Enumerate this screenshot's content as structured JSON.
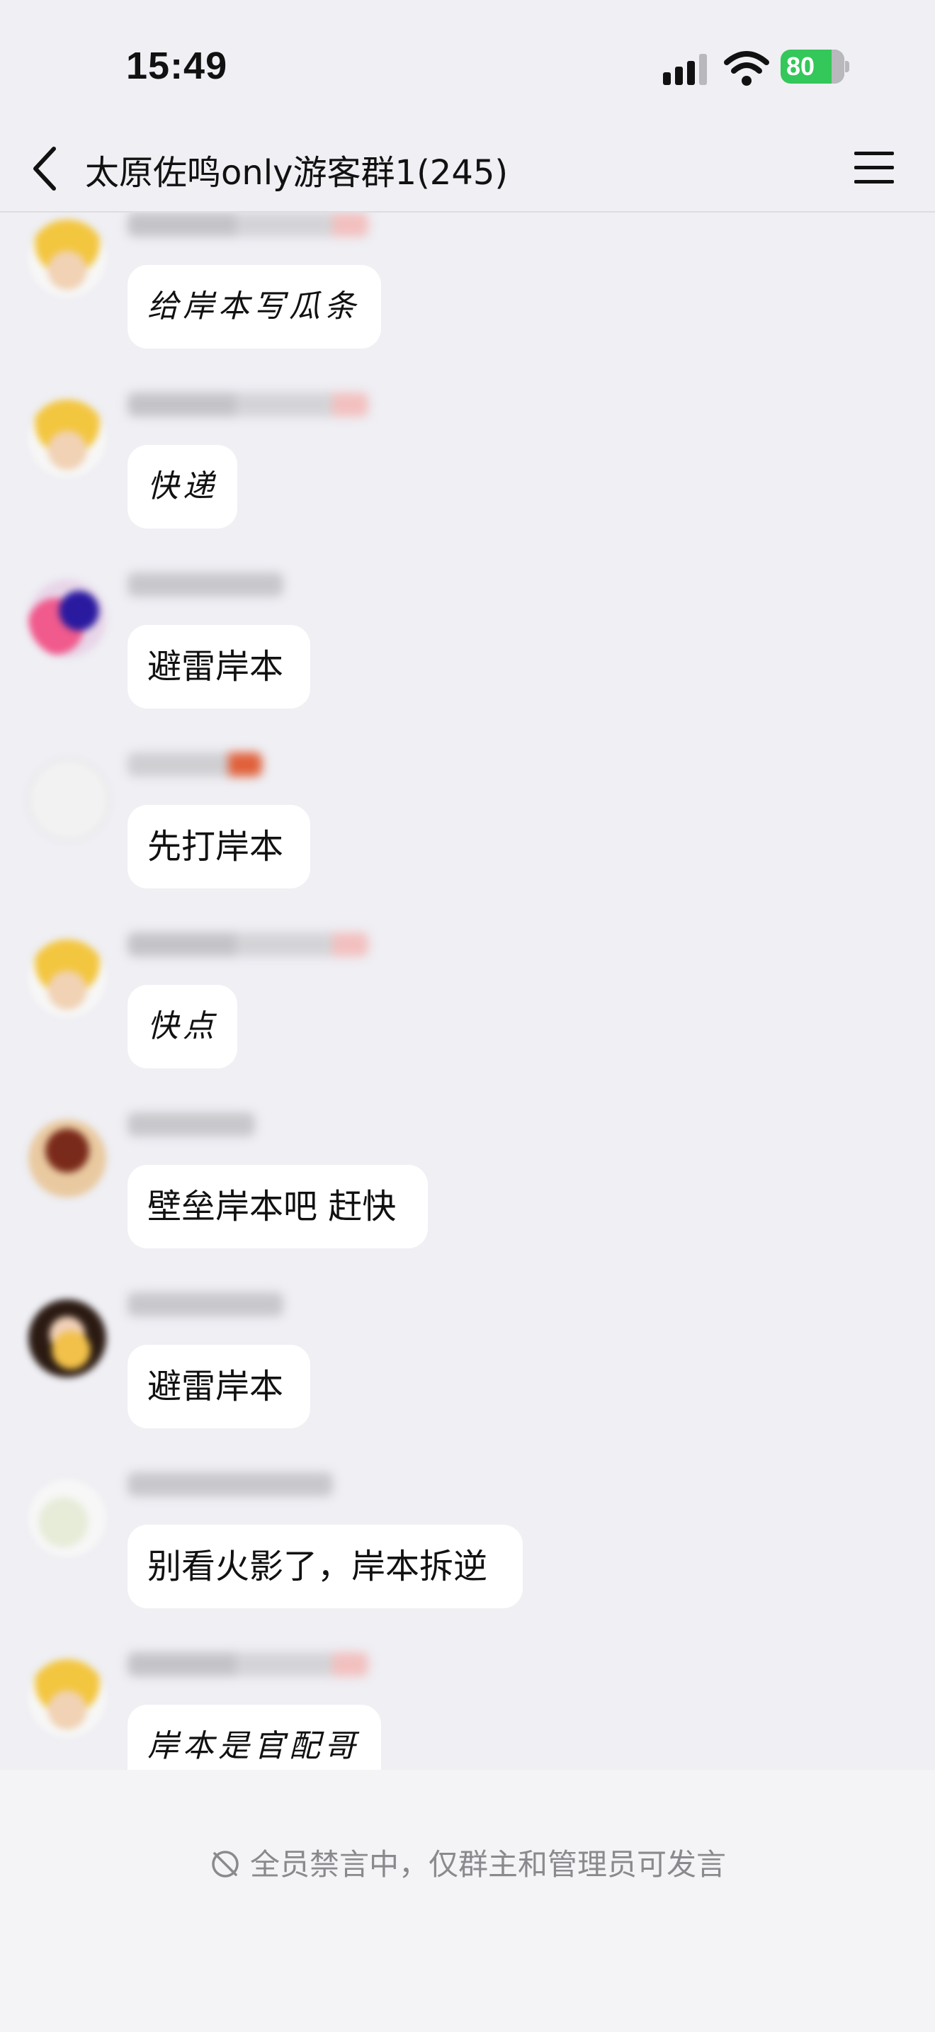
{
  "status_bar": {
    "time": "15:49",
    "battery": "80"
  },
  "header": {
    "title": "太原佐鸣only游客群1(245)"
  },
  "messages": [
    {
      "text": "给岸本写瓜条"
    },
    {
      "text": "快递"
    },
    {
      "text": "避雷岸本"
    },
    {
      "text": "先打岸本"
    },
    {
      "text": "快点"
    },
    {
      "text": "壁垒岸本吧 赶快"
    },
    {
      "text": "避雷岸本"
    },
    {
      "text": "别看火影了，岸本拆逆"
    },
    {
      "text": "岸本是官配哥"
    }
  ],
  "footer": {
    "notice": "全员禁言中，仅群主和管理员可发言"
  }
}
